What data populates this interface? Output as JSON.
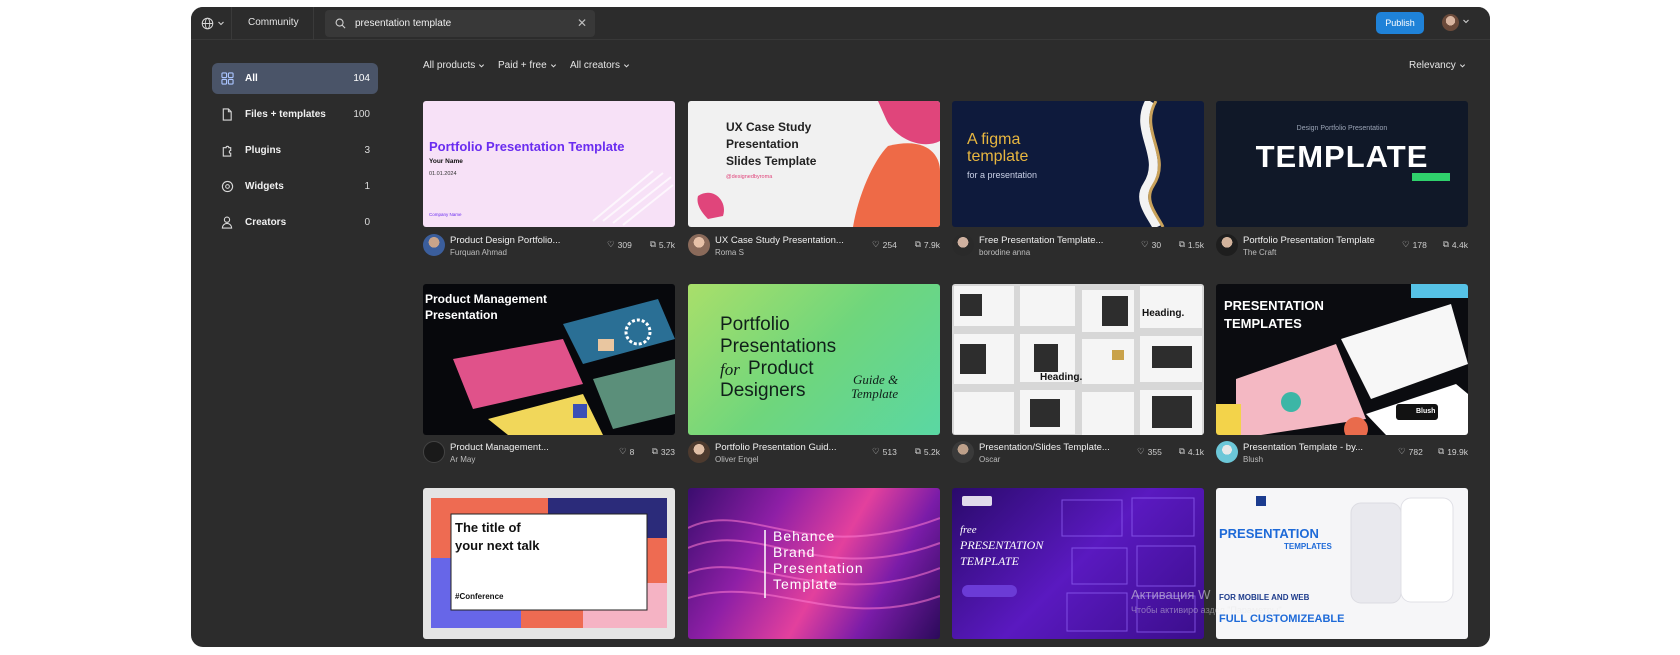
{
  "topbar": {
    "community_label": "Community",
    "search_value": "presentation template",
    "publish_label": "Publish"
  },
  "sidebar": {
    "items": [
      {
        "label": "All",
        "count": "104"
      },
      {
        "label": "Files + templates",
        "count": "100"
      },
      {
        "label": "Plugins",
        "count": "3"
      },
      {
        "label": "Widgets",
        "count": "1"
      },
      {
        "label": "Creators",
        "count": "0"
      }
    ]
  },
  "filters": {
    "products": "All products",
    "pricing": "Paid + free",
    "creators": "All creators",
    "sort": "Relevancy"
  },
  "cards": [
    {
      "title": "Product Design Portfolio...",
      "author": "Furquan Ahmad",
      "likes": "309",
      "uses": "5.7k",
      "thumb": {
        "t1": "Portfolio Presentation Template",
        "t2": "Your Name",
        "t3": "01.01.2024",
        "t4": "Company Name"
      }
    },
    {
      "title": "UX Case Study Presentation...",
      "author": "Roma S",
      "likes": "254",
      "uses": "7.9k",
      "thumb": {
        "t1": "UX Case Study",
        "t2": "Presentation",
        "t3": "Slides Template",
        "t4": "@designedbyroma"
      }
    },
    {
      "title": "Free Presentation Template...",
      "author": "borodine anna",
      "likes": "30",
      "uses": "1.5k",
      "thumb": {
        "t1": "A figma",
        "t2": "template",
        "t3": "for a presentation"
      }
    },
    {
      "title": "Portfolio Presentation Template",
      "author": "The Craft",
      "likes": "178",
      "uses": "4.4k",
      "thumb": {
        "t1": "Design Portfolio Presentation",
        "t2": "TEMPLATE"
      }
    },
    {
      "title": "Product Management...",
      "author": "Ar May",
      "likes": "8",
      "uses": "323",
      "thumb": {
        "t1": "Product Management",
        "t2": "Presentation"
      }
    },
    {
      "title": "Portfolio Presentation Guid...",
      "author": "Oliver Engel",
      "likes": "513",
      "uses": "5.2k",
      "thumb": {
        "t1": "Portfolio",
        "t2": "Presentations",
        "t3": "for",
        "t4": "Product",
        "t5": "Designers",
        "t6": "Guide &",
        "t7": "Template"
      }
    },
    {
      "title": "Presentation/Slides Template...",
      "author": "Oscar",
      "likes": "355",
      "uses": "4.1k",
      "thumb": {
        "t1": "Heading.",
        "t2": "Heading."
      }
    },
    {
      "title": "Presentation Template - by...",
      "author": "Blush",
      "likes": "782",
      "uses": "19.9k",
      "thumb": {
        "t1": "PRESENTATION",
        "t2": "TEMPLATES",
        "t3": "Blush"
      }
    },
    {
      "thumb": {
        "t1": "The title of",
        "t2": "your next talk",
        "t3": "#Conference"
      }
    },
    {
      "thumb": {
        "t1": "Behance",
        "t2": "Brand",
        "t3": "Presentation",
        "t4": "Template"
      }
    },
    {
      "thumb": {
        "t1": "free",
        "t2": "PRESENTATION",
        "t3": "TEMPLATE"
      }
    },
    {
      "thumb": {
        "t1": "PRESENTATION",
        "t2": "TEMPLATES",
        "t3": "FOR MOBILE AND WEB",
        "t4": "FULL CUSTOMIZEABLE"
      }
    }
  ],
  "watermark": {
    "line1": "Активация W",
    "line2": "Чтобы активиро                               аздел \"Параметры\"."
  },
  "help_label": "?"
}
